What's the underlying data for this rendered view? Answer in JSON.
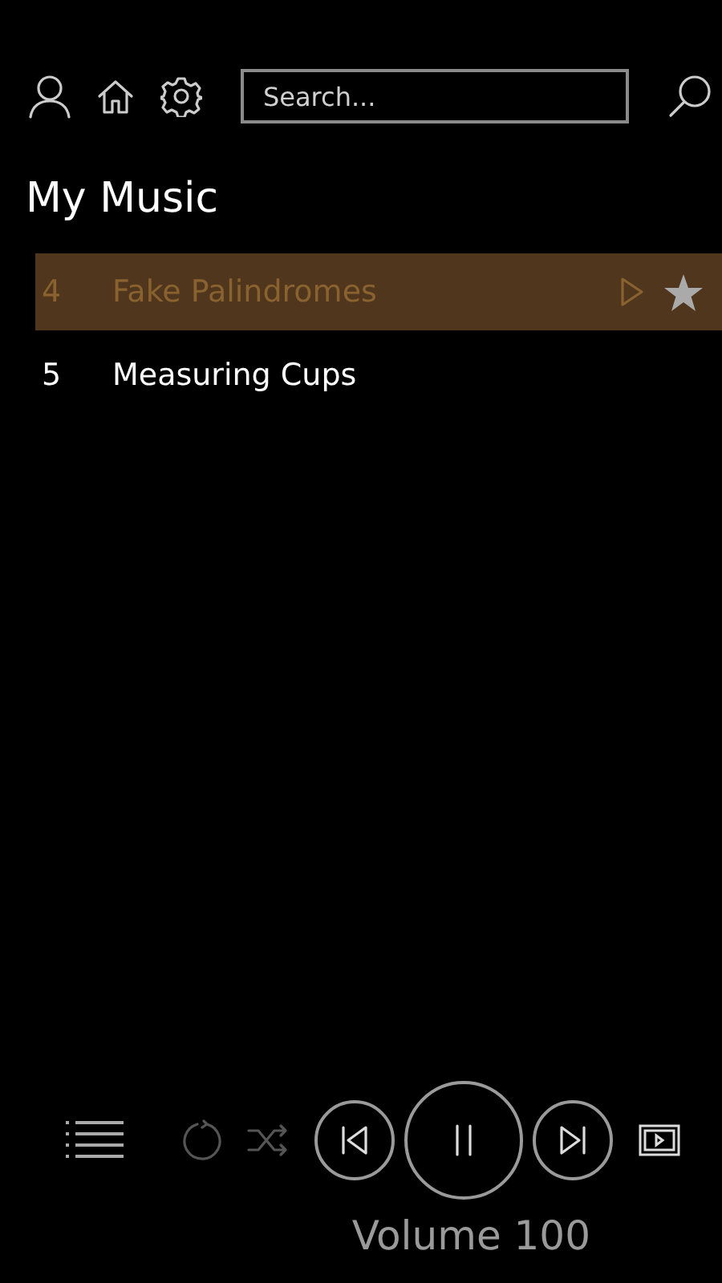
{
  "search": {
    "placeholder": "Search..."
  },
  "heading": "My Music",
  "tracks": [
    {
      "number": "4",
      "title": "Fake Palindromes",
      "selected": true,
      "starred": true
    },
    {
      "number": "5",
      "title": "Measuring Cups",
      "selected": false,
      "starred": false
    }
  ],
  "player": {
    "repeat_on": false,
    "shuffle_on": false,
    "volume": "Volume 100"
  }
}
